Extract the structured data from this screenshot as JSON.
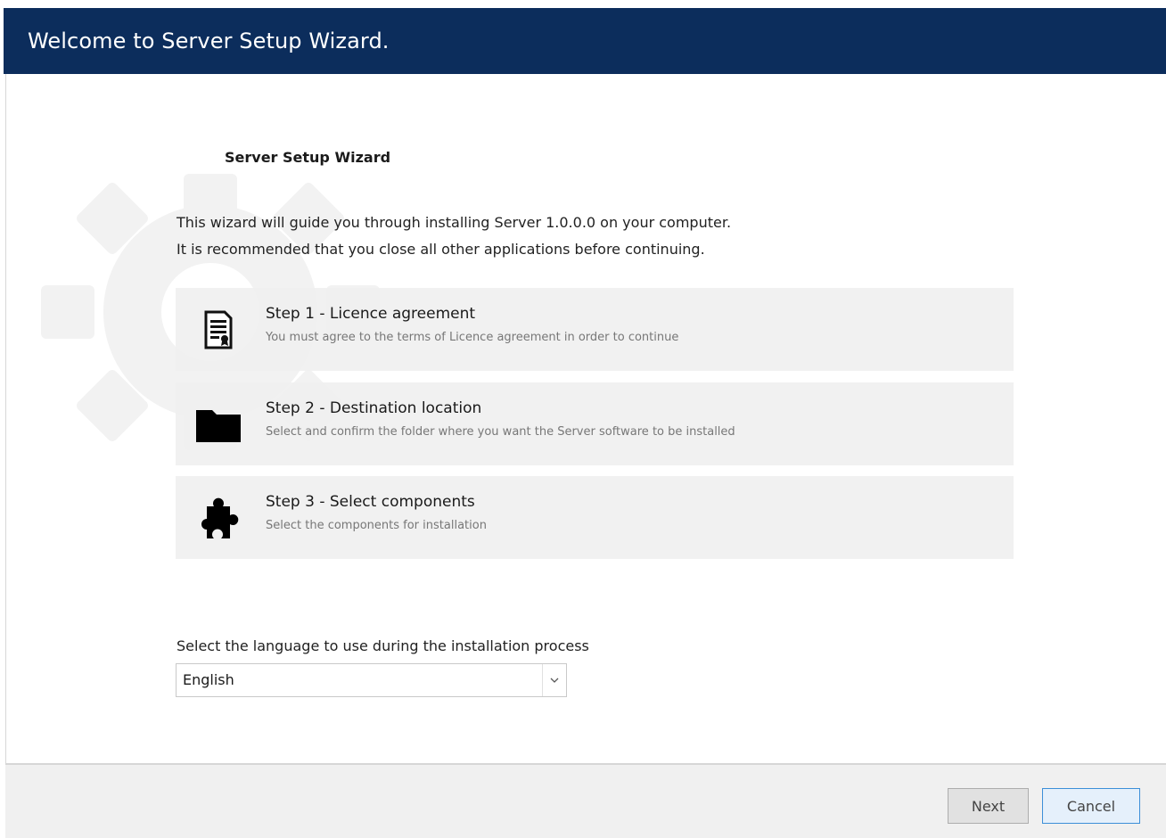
{
  "window": {
    "title": "Welcome to Server Setup Wizard."
  },
  "main": {
    "heading": "Server Setup Wizard",
    "intro_line1": "This wizard will guide you through installing Server 1.0.0.0 on your computer.",
    "intro_line2": "It is recommended that you close all other applications before continuing.",
    "steps": [
      {
        "title": "Step 1 - Licence agreement",
        "description": "You must agree to the terms of Licence agreement in order to continue",
        "icon": "document-icon"
      },
      {
        "title": "Step 2 - Destination location",
        "description": "Select and confirm the folder where you want the Server software to be installed",
        "icon": "folder-icon"
      },
      {
        "title": "Step 3 - Select components",
        "description": "Select the components for installation",
        "icon": "puzzle-icon"
      }
    ],
    "language_label": "Select the language to use during the installation process",
    "language_value": "English"
  },
  "footer": {
    "next_label": "Next",
    "cancel_label": "Cancel"
  },
  "colors": {
    "header_bg": "#0c2d5c",
    "step_bg": "#f0f0f0",
    "footer_bg": "#f0f0f0",
    "focus_border": "#3c8fd8"
  }
}
